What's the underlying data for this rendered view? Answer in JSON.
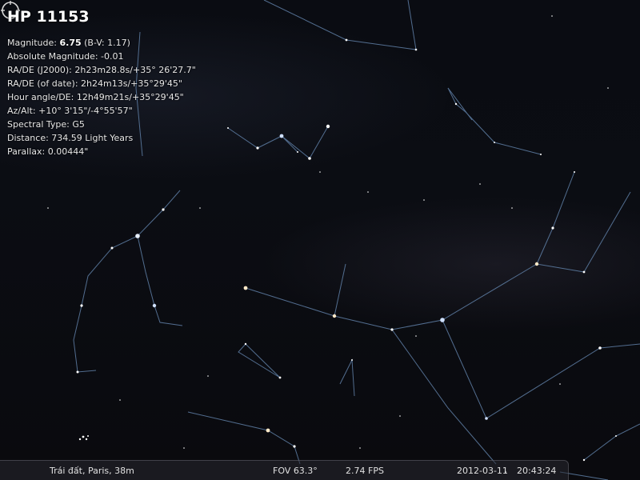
{
  "selected_object": {
    "name": "HP 11153",
    "magnitude_label": "Magnitude: ",
    "magnitude_value": "6.75",
    "magnitude_bv": " (B-V: 1.17)",
    "absolute_magnitude": "Absolute Magnitude: -0.01",
    "ra_de_j2000": "RA/DE (J2000): 2h23m28.8s/+35° 26'27.7\"",
    "ra_de_date": "RA/DE (of date): 2h24m13s/+35°29'45\"",
    "hour_angle": "Hour angle/DE: 12h49m21s/+35°29'45\"",
    "az_alt": "Az/Alt: +10° 3'15\"/-4°55'57\"",
    "spectral_type": "Spectral Type: G5",
    "distance": "Distance: 734.59 Light Years",
    "parallax": "Parallax: 0.00444\""
  },
  "status_bar": {
    "location": "Trái đất, Paris, 38m",
    "fov": "FOV 63.3°",
    "fps": "2.74 FPS",
    "date": "2012-03-11",
    "time": "20:43:24"
  },
  "colors": {
    "constellation_line": "#5f7fa6",
    "star": "#ffffff",
    "selection_marker": "#d8d8d8",
    "status_bar_bg": "#28282f"
  },
  "icons": {
    "selection": "target-reticle-icon"
  }
}
